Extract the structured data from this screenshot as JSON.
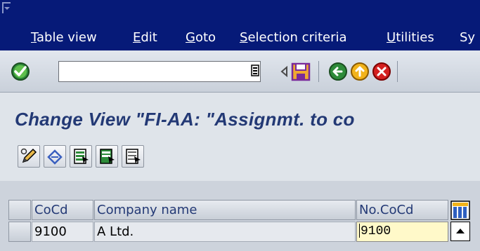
{
  "menubar": {
    "items": [
      {
        "label": "Table view",
        "accel": "T"
      },
      {
        "label": "Edit",
        "accel": "E"
      },
      {
        "label": "Goto",
        "accel": "G"
      },
      {
        "label": "Selection criteria",
        "accel": "S"
      },
      {
        "label": "Utilities",
        "accel": "U"
      },
      {
        "label": "Sy",
        "accel": ""
      }
    ]
  },
  "toolbar": {
    "command_field_value": "",
    "icons": [
      "enter-checkmark-icon",
      "history-dropdown-icon",
      "previous-arrow-icon",
      "save-icon",
      "back-icon",
      "exit-icon",
      "cancel-icon"
    ]
  },
  "title": {
    "text": "Change View \"FI-AA: \"Assignmt. to co"
  },
  "app_toolbar": {
    "icons": [
      "edit-pencil-icon",
      "undo-icon",
      "select-all-icon",
      "select-block-icon",
      "deselect-all-icon"
    ]
  },
  "table": {
    "columns": [
      "CoCd",
      "Company name",
      "No.CoCd"
    ],
    "rows": [
      {
        "cocd": "9100",
        "company_name": "A Ltd.",
        "no_cocd": "9100"
      }
    ]
  },
  "colors": {
    "menubar_bg": "#061a78",
    "title_text": "#233975",
    "edit_cell_bg": "#fff9c9"
  }
}
